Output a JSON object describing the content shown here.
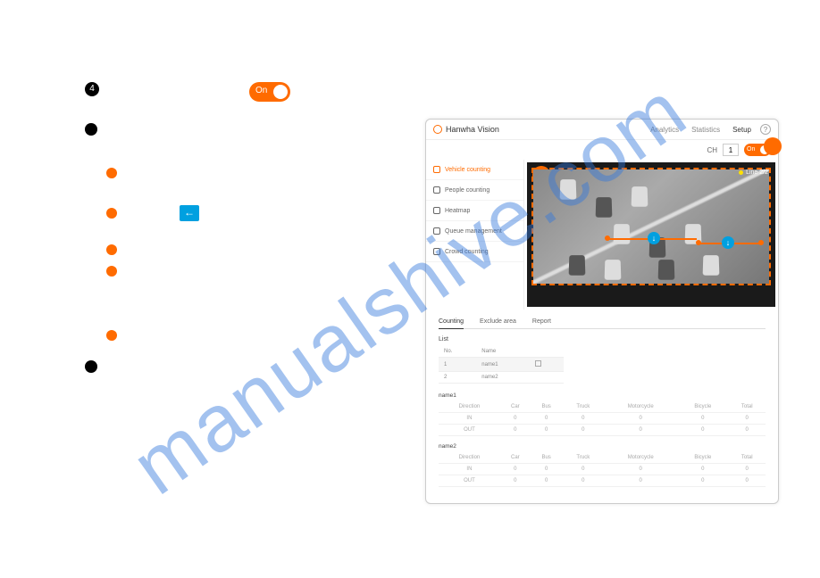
{
  "watermark": "manualshive.com",
  "step": {
    "num": "4",
    "toggle": "On"
  },
  "left": {
    "arrow_glyph": "←"
  },
  "panel": {
    "brand": "Hanwha Vision",
    "tabs": {
      "analytics": "Analytics",
      "statistics": "Statistics",
      "setup": "Setup"
    },
    "help": "?",
    "ch_label": "CH",
    "ch_value": "1",
    "mini_toggle": "On",
    "line_badge": "Line  2/2",
    "sidebar": {
      "items": [
        "Vehicle counting",
        "People counting",
        "Heatmap",
        "Queue management",
        "Crowd counting"
      ]
    },
    "subtabs": {
      "counting": "Counting",
      "exclude": "Exclude area",
      "report": "Report"
    },
    "list_label": "List",
    "list": {
      "cols": {
        "no": "No.",
        "name": "Name"
      },
      "rows": [
        {
          "no": "1",
          "name": "name1"
        },
        {
          "no": "2",
          "name": "name2"
        }
      ]
    },
    "data": {
      "cols": [
        "Direction",
        "Car",
        "Bus",
        "Truck",
        "Motorcycle",
        "Bicycle",
        "Total"
      ],
      "blocks": [
        {
          "title": "name1",
          "rows": [
            {
              "dir": "IN",
              "vals": [
                "0",
                "0",
                "0",
                "0",
                "0",
                "0"
              ]
            },
            {
              "dir": "OUT",
              "vals": [
                "0",
                "0",
                "0",
                "0",
                "0",
                "0"
              ]
            }
          ]
        },
        {
          "title": "name2",
          "rows": [
            {
              "dir": "IN",
              "vals": [
                "0",
                "0",
                "0",
                "0",
                "0",
                "0"
              ]
            },
            {
              "dir": "OUT",
              "vals": [
                "0",
                "0",
                "0",
                "0",
                "0",
                "0"
              ]
            }
          ]
        }
      ]
    }
  }
}
